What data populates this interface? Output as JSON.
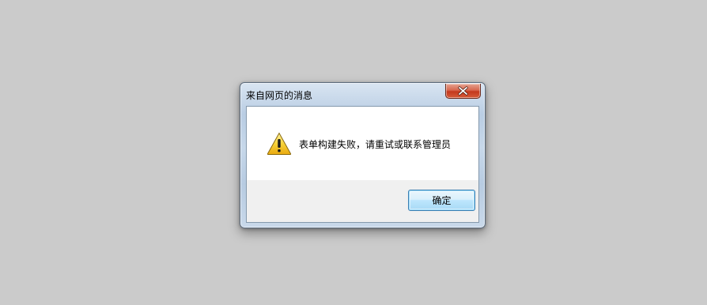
{
  "dialog": {
    "title": "来自网页的消息",
    "message": "表单构建失败，请重试或联系管理员",
    "ok_label": "确定",
    "icons": {
      "close": "close-icon",
      "warning": "warning-icon"
    }
  },
  "colors": {
    "desktop_background": "#cbcbcb",
    "close_button": "#c4381d",
    "ok_button_border": "#3c7fb1",
    "warning_fill": "#f5c518"
  }
}
